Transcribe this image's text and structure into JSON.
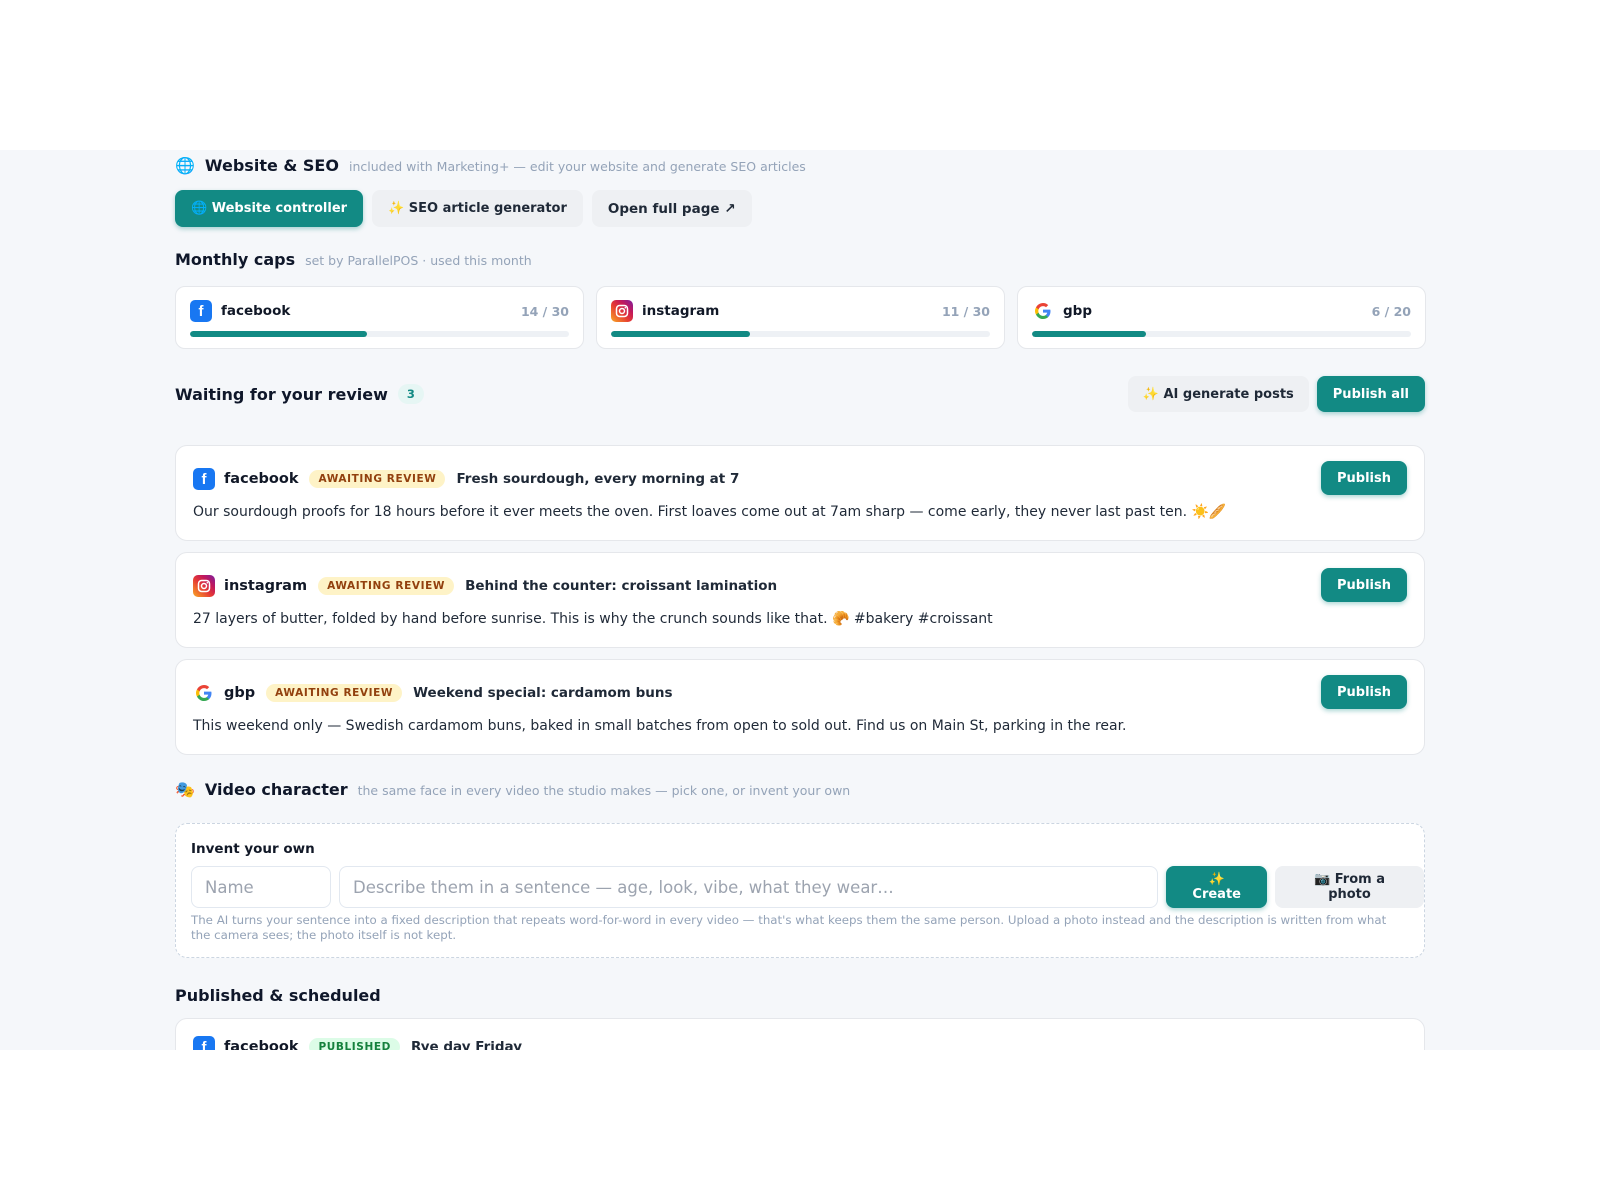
{
  "website": {
    "emoji": "🌐",
    "title": "Website & SEO",
    "subtitle": "included with Marketing+ — edit your website and generate SEO articles",
    "tabs": [
      {
        "label": "🌐 Website controller",
        "active": true
      },
      {
        "label": "✨ SEO article generator",
        "active": false
      },
      {
        "label": "Open full page ↗",
        "active": false
      }
    ]
  },
  "caps": {
    "title": "Monthly caps",
    "subtitle": "set by ParallelPOS · used this month",
    "items": [
      {
        "platform": "facebook",
        "count": "14 / 30",
        "fraction": 0.4667,
        "icon": "facebook-icon"
      },
      {
        "platform": "instagram",
        "count": "11 / 30",
        "fraction": 0.3667,
        "icon": "instagram-icon"
      },
      {
        "platform": "gbp",
        "count": "6 / 20",
        "fraction": 0.3,
        "icon": "google-icon"
      }
    ]
  },
  "review": {
    "title": "Waiting for your review",
    "count": "3",
    "ai_button": "✨ AI generate posts",
    "publish_all": "Publish all",
    "posts": [
      {
        "platform": "facebook",
        "status": "AWAITING REVIEW",
        "title": "Fresh sourdough, every morning at 7",
        "body": "Our sourdough proofs for 18 hours before it ever meets the oven. First loaves come out at 7am sharp — come early, they never last past ten. ☀️🥖",
        "button": "Publish"
      },
      {
        "platform": "instagram",
        "status": "AWAITING REVIEW",
        "title": "Behind the counter: croissant lamination",
        "body": "27 layers of butter, folded by hand before sunrise. This is why the crunch sounds like that. 🥐 #bakery #croissant",
        "button": "Publish"
      },
      {
        "platform": "gbp",
        "status": "AWAITING REVIEW",
        "title": "Weekend special: cardamom buns",
        "body": "This weekend only — Swedish cardamom buns, baked in small batches from open to sold out. Find us on Main St, parking in the rear.",
        "button": "Publish"
      }
    ]
  },
  "video": {
    "emoji": "🎭",
    "title": "Video character",
    "subtitle": "the same face in every video the studio makes — pick one, or invent your own",
    "invent_label": "Invent your own",
    "name_placeholder": "Name",
    "desc_placeholder": "Describe them in a sentence — age, look, vibe, what they wear…",
    "create_button": "✨ Create",
    "photo_button": "📷 From a photo",
    "note": "The AI turns your sentence into a fixed description that repeats word-for-word in every video — that's what keeps them the same person. Upload a photo instead and the description is written from what the camera sees; the photo itself is not kept."
  },
  "published": {
    "title": "Published & scheduled",
    "posts": [
      {
        "platform": "facebook",
        "status": "PUBLISHED",
        "title": "Rye day Friday"
      }
    ]
  },
  "colors": {
    "accent": "#128a84",
    "facebook": "#1877f2"
  }
}
